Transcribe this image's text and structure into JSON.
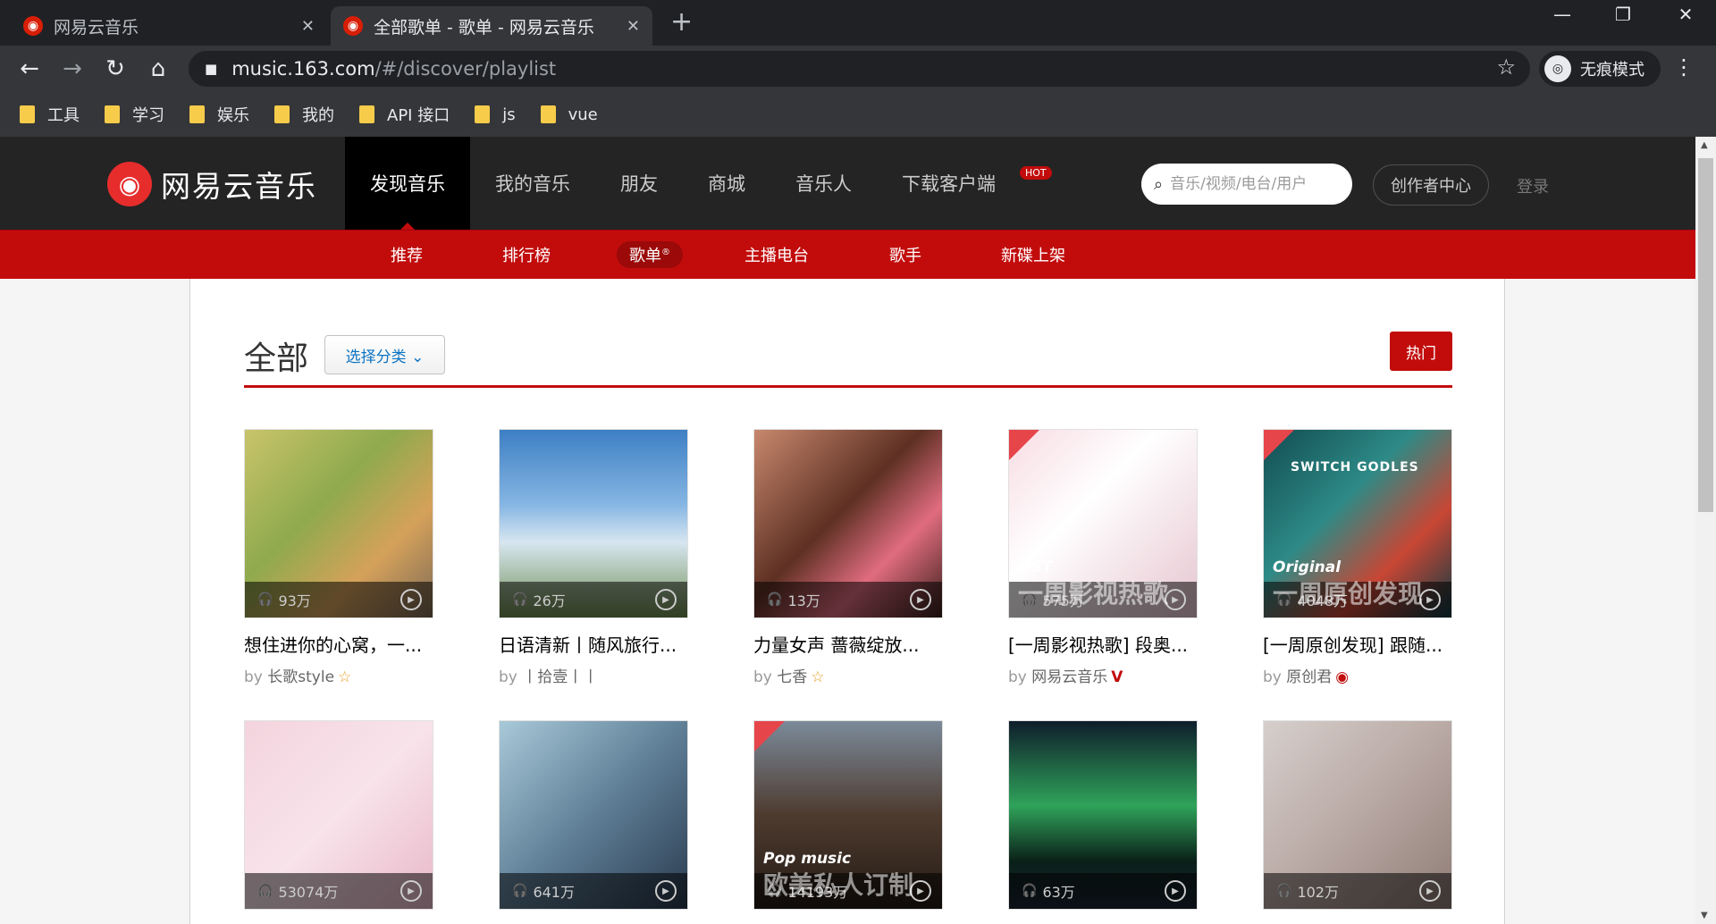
{
  "browser": {
    "tabs": [
      {
        "title": "网易云音乐",
        "active": false
      },
      {
        "title": "全部歌单 - 歌单 - 网易云音乐",
        "active": true
      }
    ],
    "url_domain": "music.163.com",
    "url_path": "/#/discover/playlist",
    "incognito_label": "无痕模式",
    "bookmarks": [
      "工具",
      "学习",
      "娱乐",
      "我的",
      "API 接口",
      "js",
      "vue"
    ]
  },
  "site": {
    "brand": "网易云音乐",
    "logo_glyph": "◉",
    "nav": [
      "发现音乐",
      "我的音乐",
      "朋友",
      "商城",
      "音乐人",
      "下载客户端"
    ],
    "hot_badge": "HOT",
    "search_placeholder": "音乐/视频/电台/用户",
    "creator_center": "创作者中心",
    "login": "登录",
    "subnav": [
      "推荐",
      "排行榜",
      "歌单",
      "主播电台",
      "歌手",
      "新碟上架"
    ],
    "subnav_active_sup": "®"
  },
  "page": {
    "heading": "全部",
    "category_button": "选择分类 ⌄",
    "hot_button": "热门"
  },
  "playlists": [
    {
      "count": "93万",
      "title": "想住进你的心窝，一...",
      "by": "by",
      "author": "长歌style",
      "mark": "☆"
    },
    {
      "count": "26万",
      "title": "日语清新丨随风旅行...",
      "by": "by",
      "author": "丨拾壹丨丨",
      "mark": ""
    },
    {
      "count": "13万",
      "title": "力量女声 蔷薇绽放...",
      "by": "by",
      "author": "七香",
      "mark": "☆"
    },
    {
      "count": "575万",
      "title": "[一周影视热歌] 段奥...",
      "by": "by",
      "author": "网易云音乐",
      "mark": "V",
      "overtext": "OST",
      "bigtext": "一周影视热歌"
    },
    {
      "count": "4048万",
      "title": "[一周原创发现] 跟随...",
      "by": "by",
      "author": "原创君",
      "mark": "◉",
      "overtext": "Original",
      "bigtext": "一周原创发现",
      "cover_text": "SWITCH GODLES"
    },
    {
      "count": "53074万",
      "title": "",
      "by": "",
      "author": "",
      "mark": ""
    },
    {
      "count": "641万",
      "title": "",
      "by": "",
      "author": "",
      "mark": ""
    },
    {
      "count": "14193万",
      "title": "",
      "by": "",
      "author": "",
      "mark": "",
      "overtext": "Pop music",
      "bigtext": "欧美私人订制"
    },
    {
      "count": "63万",
      "title": "",
      "by": "",
      "author": "",
      "mark": ""
    },
    {
      "count": "102万",
      "title": "",
      "by": "",
      "author": "",
      "mark": ""
    }
  ],
  "colors": {
    "accent": "#c20c0c",
    "header_bg": "#242424",
    "browser_bg": "#202124"
  },
  "icons": {
    "headphones": "🎧",
    "play": "▶",
    "lock": "🔒",
    "star": "☆",
    "back": "←",
    "forward": "→",
    "reload": "↻",
    "home": "⌂",
    "search": "⌕"
  }
}
